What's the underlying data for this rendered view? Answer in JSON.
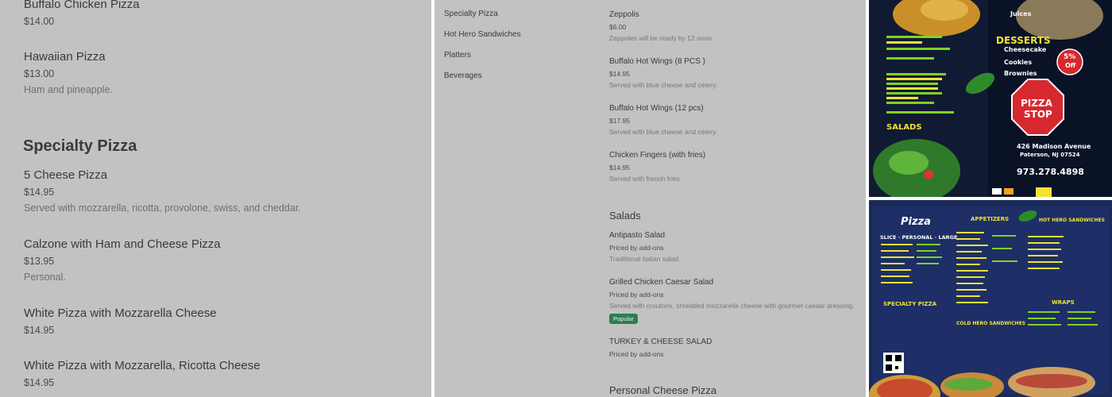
{
  "left": {
    "items_top": [
      {
        "name": "Buffalo Chicken Pizza",
        "price": "$14.00"
      },
      {
        "name": "Hawaiian Pizza",
        "price": "$13.00",
        "desc": "Ham and pineapple."
      }
    ],
    "section_heading": "Specialty Pizza",
    "items_specialty": [
      {
        "name": "5 Cheese Pizza",
        "price": "$14.95",
        "desc": "Served with mozzarella, ricotta, provolone, swiss, and cheddar."
      },
      {
        "name": "Calzone with Ham and Cheese Pizza",
        "price": "$13.95",
        "desc": "Personal."
      },
      {
        "name": "White Pizza with Mozzarella Cheese",
        "price": "$14.95"
      },
      {
        "name": "White Pizza with Mozzarella, Ricotta Cheese",
        "price": "$14.95"
      }
    ]
  },
  "middle": {
    "nav": [
      "Specialty Pizza",
      "Hot Hero Sandwiches",
      "Platters",
      "Beverages"
    ],
    "items_top": [
      {
        "name": "Zeppolis",
        "price": "$6.00",
        "desc": "Zeppoles will be ready by 12 noon."
      },
      {
        "name": "Buffalo Hot Wings (8 PCS )",
        "price": "$14.95",
        "desc": "Served with blue cheese and celery."
      },
      {
        "name": "Buffalo Hot Wings (12 pcs)",
        "price": "$17.95",
        "desc": "Served with blue cheese and celery."
      },
      {
        "name": "Chicken Fingers (with fries)",
        "price": "$14.95",
        "desc": "Served with french fries."
      }
    ],
    "salads_heading": "Salads",
    "salads": [
      {
        "name": "Antipasto Salad",
        "price": "Priced by add-ons",
        "desc": "Traditional Italian salad."
      },
      {
        "name": "Grilled Chicken Caesar Salad",
        "price": "Priced by add-ons",
        "desc": "Served with croutons, shredded mozzarella cheese with gourmet caesar dressing.",
        "badge": "Popular"
      },
      {
        "name": "TURKEY & CHEESE SALAD",
        "price": "Priced by add-ons"
      }
    ],
    "next_heading": "Personal Cheese Pizza"
  },
  "photos": {
    "top": {
      "desserts": "DESSERTS",
      "dessert_items": [
        "Cheesecake",
        "Cookies",
        "Brownies"
      ],
      "juices": "Juices",
      "salads_title": "SALADS",
      "offer_pct": "5%",
      "offer_off": "Off",
      "logo_line1": "PIZZA",
      "logo_line2": "STOP",
      "address1": "426 Madison Avenue",
      "address2": "Paterson, NJ 07524",
      "phone": "973.278.4898"
    },
    "bottom": {
      "brand": "Pizza",
      "appetizers": "APPETIZERS",
      "hot_hero": "HOT HERO SANDWICHES",
      "slice_line": "SLICE · PERSONAL · LARGE",
      "specialty": "SPECIALTY PIZZA",
      "cold_hero": "COLD HERO SANDWICHES",
      "wraps": "WRAPS"
    }
  },
  "colors": {
    "overlay_gray": "#c2c2c2",
    "text_dark": "#3a3a3a",
    "badge_green": "#2e7d52",
    "flyer_navy": "#0a1226",
    "flyer_yellow": "#f2e233",
    "flyer_green": "#7ed321",
    "logo_red": "#d7282f"
  }
}
